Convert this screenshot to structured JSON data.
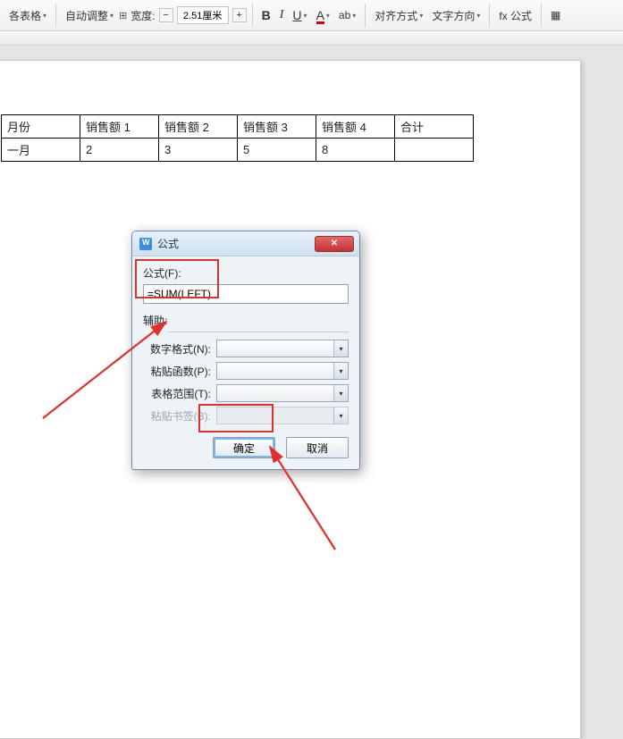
{
  "toolbar": {
    "table_label": "各表格",
    "auto_adjust": "自动调整",
    "width_label": "宽度:",
    "width_value": "2.51厘米",
    "bold": "B",
    "italic": "I",
    "underline": "U",
    "color": "A",
    "highlight": "ab",
    "align_label": "对齐方式",
    "text_dir": "文字方向",
    "formula_btn": "fx 公式",
    "tool_icon": "▦"
  },
  "table": {
    "headers": [
      "月份",
      "销售额 1",
      "销售额 2",
      "销售额 3",
      "销售额 4",
      "合计"
    ],
    "row": [
      "一月",
      "2",
      "3",
      "5",
      "8",
      ""
    ]
  },
  "dialog": {
    "title": "公式",
    "formula_label": "公式(F):",
    "formula_value": "=SUM(LEFT)",
    "assist_label": "辅助:",
    "num_format": "数字格式(N):",
    "paste_fn": "粘贴函数(P):",
    "range": "表格范围(T):",
    "paste_bm": "粘贴书签(B):",
    "ok": "确定",
    "cancel": "取消"
  }
}
